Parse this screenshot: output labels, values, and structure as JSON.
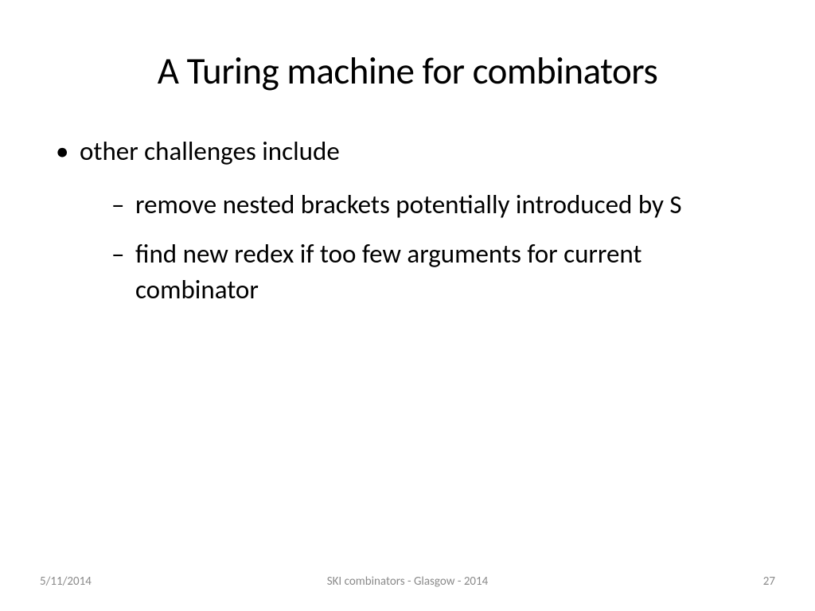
{
  "title": "A Turing machine for combinators",
  "bullets": {
    "l1": "other challenges include",
    "l2a": "remove nested brackets potentially introduced by S",
    "l2b": "find new redex if too few arguments for current combinator"
  },
  "footer": {
    "date": "5/11/2014",
    "center": "SKI combinators - Glasgow - 2014",
    "page": "27"
  }
}
